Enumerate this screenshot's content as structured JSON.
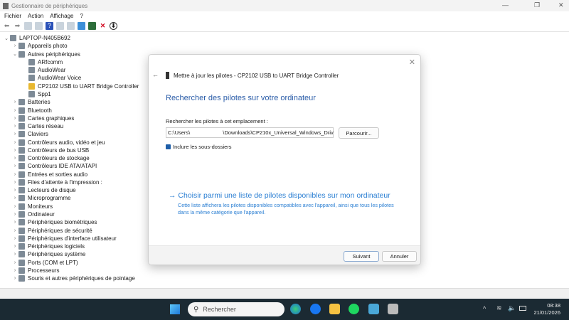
{
  "window": {
    "title": "Gestionnaire de périphériques"
  },
  "menu": [
    "Fichier",
    "Action",
    "Affichage",
    "?"
  ],
  "tree": [
    {
      "label": "LAPTOP-N405B692",
      "level": 0,
      "expander": "v"
    },
    {
      "label": "Appareils photo",
      "level": 1,
      "expander": ">"
    },
    {
      "label": "Autres périphériques",
      "level": 1,
      "expander": "v"
    },
    {
      "label": "ARfcomm",
      "level": 2,
      "expander": ""
    },
    {
      "label": "AudioWear",
      "level": 2,
      "expander": ""
    },
    {
      "label": "AudioWear Voice",
      "level": 2,
      "expander": ""
    },
    {
      "label": "CP2102 USB to UART Bridge Controller",
      "level": 2,
      "expander": "",
      "warning": true
    },
    {
      "label": "Spp1",
      "level": 2,
      "expander": ""
    },
    {
      "label": "Batteries",
      "level": 1,
      "expander": ">"
    },
    {
      "label": "Bluetooth",
      "level": 1,
      "expander": ">"
    },
    {
      "label": "Cartes graphiques",
      "level": 1,
      "expander": ">"
    },
    {
      "label": "Cartes réseau",
      "level": 1,
      "expander": ">"
    },
    {
      "label": "Claviers",
      "level": 1,
      "expander": ">"
    },
    {
      "label": "Contrôleurs audio, vidéo et jeu",
      "level": 1,
      "expander": ">"
    },
    {
      "label": "Contrôleurs de bus USB",
      "level": 1,
      "expander": ">"
    },
    {
      "label": "Contrôleurs de stockage",
      "level": 1,
      "expander": ">"
    },
    {
      "label": "Contrôleurs IDE ATA/ATAPI",
      "level": 1,
      "expander": ">"
    },
    {
      "label": "Entrées et sorties audio",
      "level": 1,
      "expander": ">"
    },
    {
      "label": "Files d'attente à l'impression :",
      "level": 1,
      "expander": ">"
    },
    {
      "label": "Lecteurs de disque",
      "level": 1,
      "expander": ">"
    },
    {
      "label": "Microprogramme",
      "level": 1,
      "expander": ">"
    },
    {
      "label": "Moniteurs",
      "level": 1,
      "expander": ">"
    },
    {
      "label": "Ordinateur",
      "level": 1,
      "expander": ">"
    },
    {
      "label": "Périphériques biométriques",
      "level": 1,
      "expander": ">"
    },
    {
      "label": "Périphériques de sécurité",
      "level": 1,
      "expander": ">"
    },
    {
      "label": "Périphériques d'interface utilisateur",
      "level": 1,
      "expander": ">"
    },
    {
      "label": "Périphériques logiciels",
      "level": 1,
      "expander": ">"
    },
    {
      "label": "Périphériques système",
      "level": 1,
      "expander": ">"
    },
    {
      "label": "Ports (COM et LPT)",
      "level": 1,
      "expander": ">"
    },
    {
      "label": "Processeurs",
      "level": 1,
      "expander": ">"
    },
    {
      "label": "Souris et autres périphériques de pointage",
      "level": 1,
      "expander": ">"
    }
  ],
  "dialog": {
    "title": "Mettre à jour les pilotes - CP2102 USB to UART Bridge Controller",
    "heading": "Rechercher des pilotes sur votre ordinateur",
    "location_label": "Rechercher les pilotes à cet emplacement :",
    "path_start": "C:\\Users\\",
    "path_end": "\\Downloads\\CP210x_Universal_Windows_Driv",
    "browse": "Parcourir...",
    "include_subfolders": "Inclure les sous-dossiers",
    "include_checked": true,
    "pick_link": "Choisir parmi une liste de pilotes disponibles sur mon ordinateur",
    "pick_desc": "Cette liste affichera les pilotes disponibles compatibles avec l'appareil, ainsi que tous les pilotes dans la même catégorie que l'appareil.",
    "next": "Suivant",
    "cancel": "Annuler"
  },
  "taskbar": {
    "search": "Rechercher",
    "time": "08:38",
    "date": "21/01/2026"
  },
  "colors": {
    "accent": "#2a5ca8",
    "link": "#2b7fd3",
    "taskbar": "#1b2a33"
  }
}
